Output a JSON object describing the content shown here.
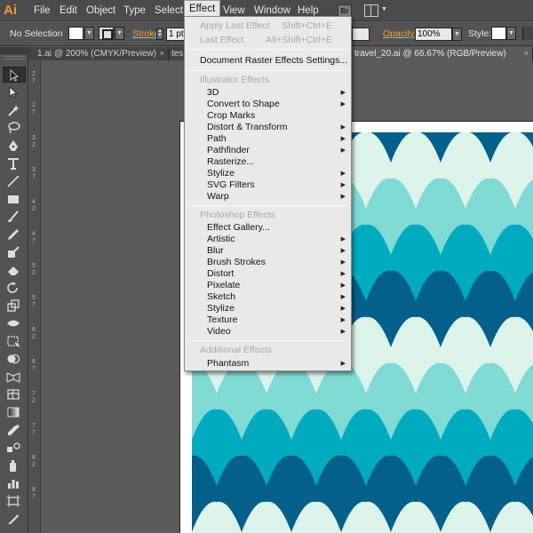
{
  "app": {
    "logo": "Ai"
  },
  "menubar": {
    "items": [
      {
        "label": "File"
      },
      {
        "label": "Edit"
      },
      {
        "label": "Object"
      },
      {
        "label": "Type"
      },
      {
        "label": "Select"
      },
      {
        "label": "Effect"
      },
      {
        "label": "View"
      },
      {
        "label": "Window"
      },
      {
        "label": "Help"
      }
    ],
    "bridge_badge": "Br"
  },
  "controlbar": {
    "selection": "No Selection",
    "stroke_label": "Stroke:",
    "stroke_weight": "1 pt",
    "opacity_label": "Opacity:",
    "opacity_value": "100%",
    "style_label": "Style:"
  },
  "tabs": [
    {
      "label": "1.ai @ 200% (CMYK/Preview)",
      "close": "×"
    },
    {
      "label": "tes",
      "close": ""
    },
    {
      "label": "travel_20.ai @ 66.67% (RGB/Preview)",
      "close": "×"
    }
  ],
  "ruler": {
    "numbers": [
      "2",
      "7",
      "2",
      "7",
      "3",
      "2",
      "3",
      "7",
      "4",
      "2",
      "4",
      "7",
      "5",
      "2",
      "5",
      "7",
      "6",
      "2",
      "6",
      "7",
      "7",
      "2",
      "7",
      "7",
      "8",
      "2",
      "8",
      "7"
    ]
  },
  "effect_menu": {
    "apply_last": {
      "label": "Apply Last Effect",
      "shortcut": "Shift+Ctrl+E"
    },
    "last_effect": {
      "label": "Last Effect",
      "shortcut": "Alt+Shift+Ctrl+E"
    },
    "doc_raster": "Document Raster Effects Settings...",
    "illustrator_header": "Illustrator Effects",
    "illustrator_items": [
      "3D",
      "Convert to Shape",
      "Crop Marks",
      "Distort & Transform",
      "Path",
      "Pathfinder",
      "Rasterize...",
      "Stylize",
      "SVG Filters",
      "Warp"
    ],
    "photoshop_header": "Photoshop Effects",
    "photoshop_items": [
      "Effect Gallery...",
      "Artistic",
      "Blur",
      "Brush Strokes",
      "Distort",
      "Pixelate",
      "Sketch",
      "Stylize",
      "Texture",
      "Video"
    ],
    "additional_header": "Additional Effects",
    "additional_items": [
      "Phantasm"
    ]
  },
  "colors": {
    "wave_lightest": "#dcf3ea",
    "wave_light": "#7fd9d5",
    "wave_mid": "#00abc0",
    "wave_dark": "#02608a",
    "accent_orange": "#f59a23"
  }
}
